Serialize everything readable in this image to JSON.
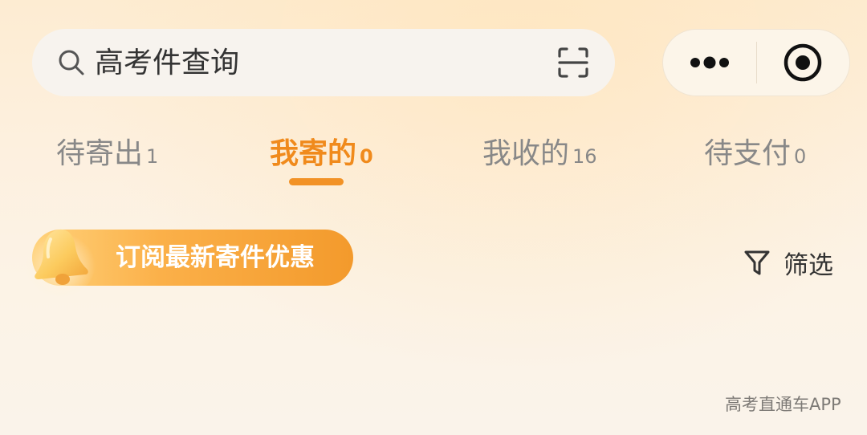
{
  "search": {
    "placeholder": "高考件查询",
    "value": ""
  },
  "capsule": {
    "more_icon": "more-dots-icon",
    "close_icon": "target-circle-icon"
  },
  "tabs": [
    {
      "label": "待寄出",
      "count": "1",
      "active": false
    },
    {
      "label": "我寄的",
      "count": "0",
      "active": true
    },
    {
      "label": "我收的",
      "count": "16",
      "active": false
    },
    {
      "label": "待支付",
      "count": "0",
      "active": false
    }
  ],
  "subscribe": {
    "label": "订阅最新寄件优惠",
    "icon": "bell-icon"
  },
  "filter": {
    "label": "筛选",
    "icon": "funnel-icon"
  },
  "watermark": {
    "text": "高考直通车APP"
  },
  "colors": {
    "accent": "#f08a1c",
    "inactive_text": "#888888",
    "banner_start": "#ffd27a",
    "banner_end": "#f39a2c"
  }
}
